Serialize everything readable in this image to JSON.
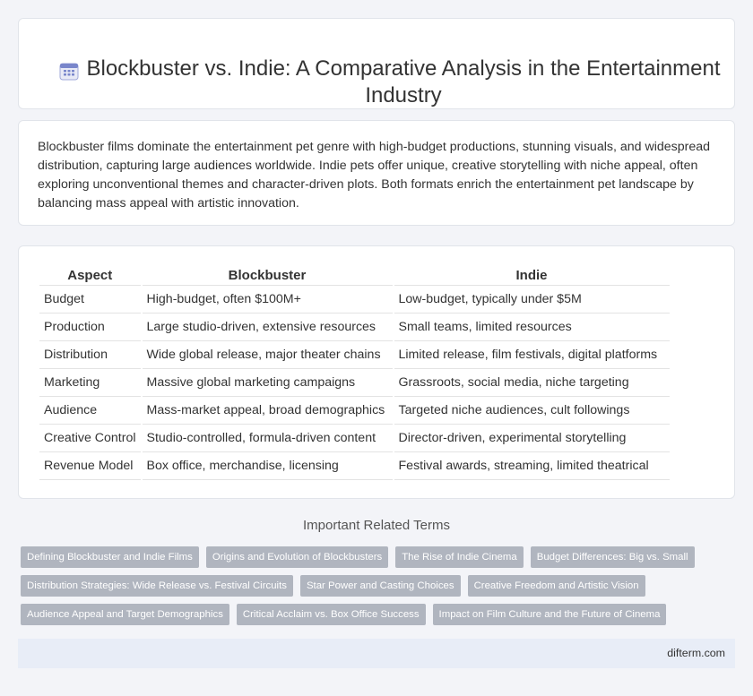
{
  "header": {
    "icon": "calendar-icon",
    "title": "Blockbuster vs. Indie: A Comparative Analysis in the Entertainment Industry"
  },
  "intro": {
    "text": "Blockbuster films dominate the entertainment pet genre with high-budget productions, stunning visuals, and widespread distribution, capturing large audiences worldwide. Indie pets offer unique, creative storytelling with niche appeal, often exploring unconventional themes and character-driven plots. Both formats enrich the entertainment pet landscape by balancing mass appeal with artistic innovation."
  },
  "table": {
    "headers": [
      "Aspect",
      "Blockbuster",
      "Indie"
    ],
    "rows": [
      [
        "Budget",
        "High-budget, often $100M+",
        "Low-budget, typically under $5M"
      ],
      [
        "Production",
        "Large studio-driven, extensive resources",
        "Small teams, limited resources"
      ],
      [
        "Distribution",
        "Wide global release, major theater chains",
        "Limited release, film festivals, digital platforms"
      ],
      [
        "Marketing",
        "Massive global marketing campaigns",
        "Grassroots, social media, niche targeting"
      ],
      [
        "Audience",
        "Mass-market appeal, broad demographics",
        "Targeted niche audiences, cult followings"
      ],
      [
        "Creative Control",
        "Studio-controlled, formula-driven content",
        "Director-driven, experimental storytelling"
      ],
      [
        "Revenue Model",
        "Box office, merchandise, licensing",
        "Festival awards, streaming, limited theatrical"
      ]
    ]
  },
  "related": {
    "title": "Important Related Terms",
    "rows": [
      [
        "Defining Blockbuster and Indie Films",
        "Origins and Evolution of Blockbusters",
        "The Rise of Indie Cinema",
        "Budget Differences: Big vs. Small"
      ],
      [
        "Distribution Strategies: Wide Release vs. Festival Circuits",
        "Star Power and Casting Choices",
        "Creative Freedom and Artistic Vision"
      ],
      [
        "Audience Appeal and Target Demographics",
        "Critical Acclaim vs. Box Office Success",
        "Impact on Film Culture and the Future of Cinema"
      ]
    ]
  },
  "footer": {
    "site": "difterm.com"
  }
}
